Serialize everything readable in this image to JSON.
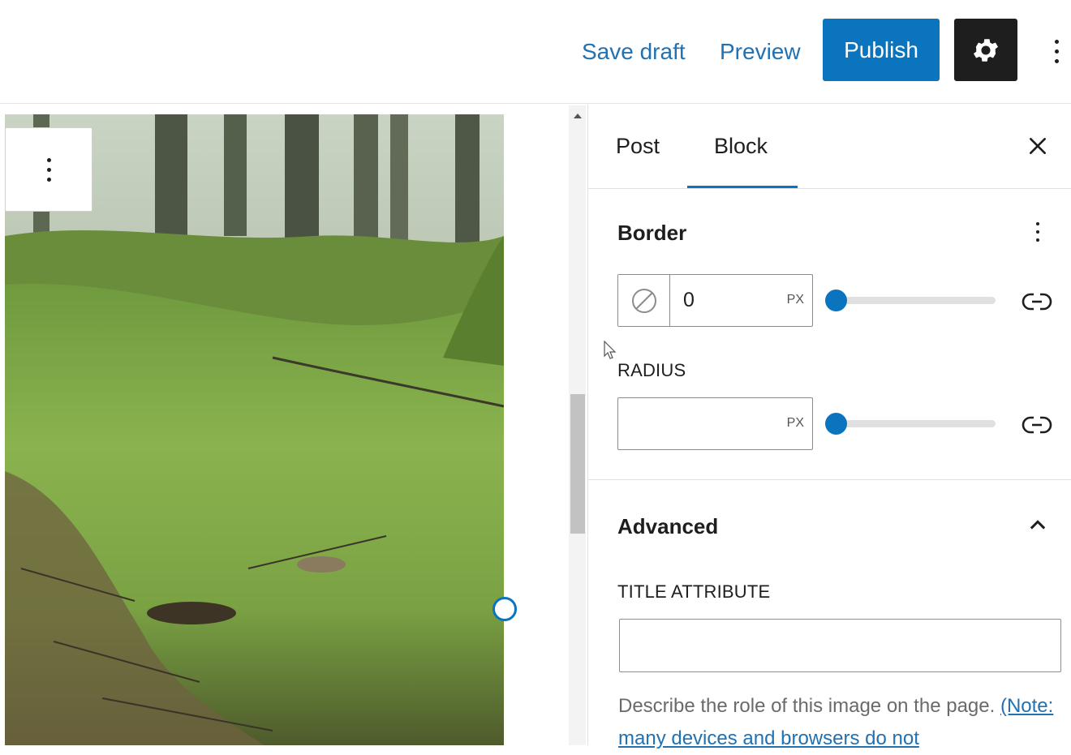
{
  "header": {
    "save_draft": "Save draft",
    "preview": "Preview",
    "publish": "Publish"
  },
  "sidebar": {
    "tabs": [
      {
        "label": "Post"
      },
      {
        "label": "Block"
      }
    ],
    "active_tab": "Block",
    "border": {
      "title": "Border",
      "width_value": "0",
      "width_unit": "PX",
      "radius_label": "RADIUS",
      "radius_value": "",
      "radius_unit": "PX"
    },
    "advanced": {
      "title": "Advanced",
      "title_attribute_label": "TITLE ATTRIBUTE",
      "title_attribute_value": "",
      "help_text": "Describe the role of this image on the page.",
      "help_link": "(Note: many devices and browsers do not"
    }
  },
  "colors": {
    "accent": "#0a74bf",
    "dark": "#1e1e1e",
    "link": "#2271b1"
  }
}
